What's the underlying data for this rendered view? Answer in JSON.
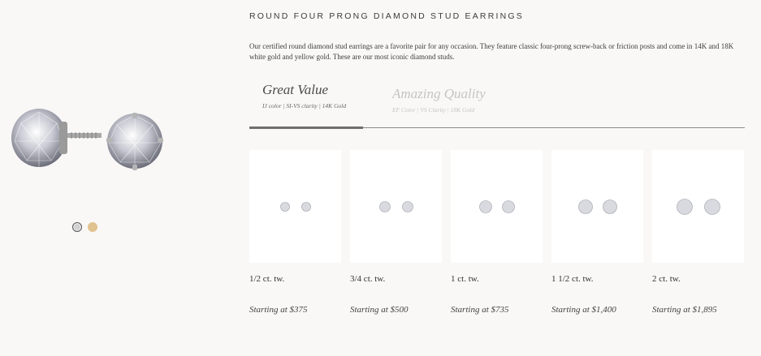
{
  "product": {
    "title": "ROUND FOUR PRONG DIAMOND STUD EARRINGS",
    "description": "Our certified round diamond stud earrings are a favorite pair for any occasion. They feature classic four-prong screw-back or friction posts and come in 14K and 18K white gold and yellow gold. These are our most iconic diamond studs."
  },
  "metal_options": [
    {
      "name": "white-gold",
      "color": "#d2d2d2",
      "selected": true
    },
    {
      "name": "yellow-gold",
      "color": "#e0c38f",
      "selected": false
    }
  ],
  "tabs": [
    {
      "title": "Great Value",
      "subtitle": "IJ color | SI-VS clarity | 14K Gold",
      "active": true
    },
    {
      "title": "Amazing Quality",
      "subtitle": "EF Color | VS Clarity | 18K Gold",
      "active": false
    }
  ],
  "products": [
    {
      "size": "1/2 ct. tw.",
      "price": "Starting at $375"
    },
    {
      "size": "3/4 ct. tw.",
      "price": "Starting at $500"
    },
    {
      "size": "1 ct. tw.",
      "price": "Starting at $735"
    },
    {
      "size": "1 1/2 ct. tw.",
      "price": "Starting at $1,400"
    },
    {
      "size": "2 ct. tw.",
      "price": "Starting at $1,895"
    }
  ],
  "colors": {
    "background": "#f9f8f7",
    "card": "#ffffff",
    "tab_rule": "#8a8a8a"
  }
}
